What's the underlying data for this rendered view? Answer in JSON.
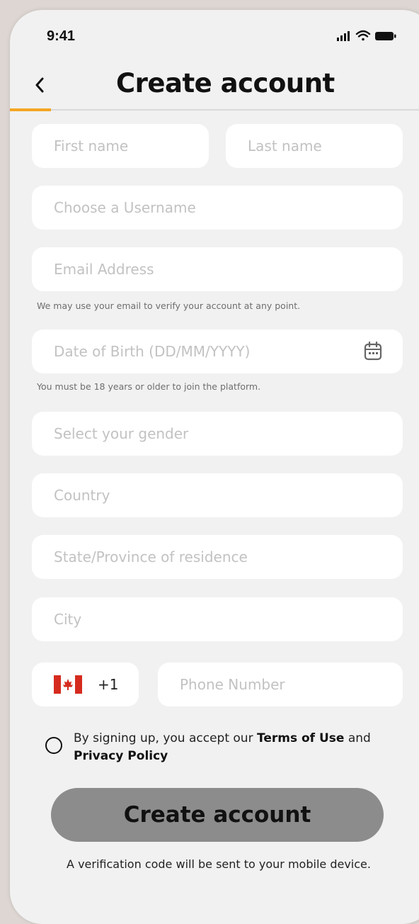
{
  "status_bar": {
    "time": "9:41"
  },
  "header": {
    "title": "Create account"
  },
  "form": {
    "first_name": {
      "placeholder": "First name",
      "value": ""
    },
    "last_name": {
      "placeholder": "Last name",
      "value": ""
    },
    "username": {
      "placeholder": "Choose a Username",
      "value": ""
    },
    "email": {
      "placeholder": "Email Address",
      "value": "",
      "helper": "We may use your email to verify your account at any point."
    },
    "dob": {
      "placeholder": "Date of Birth (DD/MM/YYYY)",
      "value": "",
      "helper": "You must be 18 years or older to join the platform."
    },
    "gender": {
      "placeholder": "Select your gender",
      "value": ""
    },
    "country": {
      "placeholder": "Country",
      "value": ""
    },
    "state": {
      "placeholder": "State/Province of residence",
      "value": ""
    },
    "city": {
      "placeholder": "City",
      "value": ""
    },
    "phone": {
      "country_code": "+1",
      "flag": "canada-flag-icon",
      "placeholder": "Phone Number",
      "value": ""
    }
  },
  "terms": {
    "prefix": "By signing up, you accept our ",
    "terms_link": "Terms of Use",
    "and": " and ",
    "privacy_link": "Privacy Policy",
    "checked": false
  },
  "submit": {
    "label": "Create account"
  },
  "footer_note": "A verification code will be sent to your mobile device.",
  "colors": {
    "accent": "#f5a623",
    "background": "#f1f1f1",
    "field": "#ffffff",
    "button": "#8c8c8c",
    "flag_red": "#d52b1e"
  }
}
